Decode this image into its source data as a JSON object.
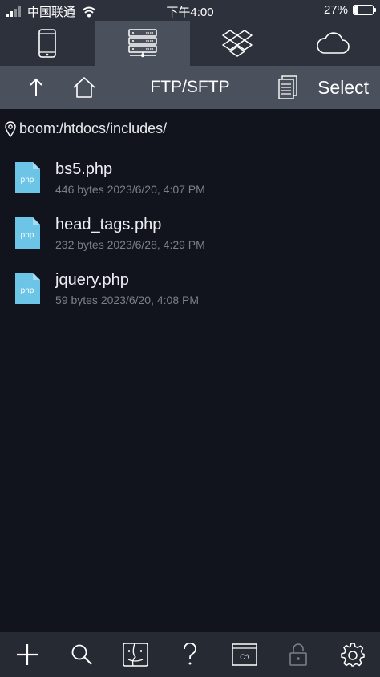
{
  "status": {
    "carrier": "中国联通",
    "time": "下午4:00",
    "battery": "27%",
    "battery_level": 0.27
  },
  "tabs": [
    {
      "name": "device",
      "icon": "phone-icon",
      "active": false
    },
    {
      "name": "server",
      "icon": "server-icon",
      "active": true
    },
    {
      "name": "dropbox",
      "icon": "dropbox-icon",
      "active": false
    },
    {
      "name": "cloud",
      "icon": "cloud-icon",
      "active": false
    }
  ],
  "toolbar": {
    "title": "FTP/SFTP",
    "select_label": "Select"
  },
  "path": "boom:/htdocs/includes/",
  "files": [
    {
      "name": "bs5.php",
      "meta": "446 bytes 2023/6/20, 4:07 PM",
      "ext": "php"
    },
    {
      "name": "head_tags.php",
      "meta": "232 bytes 2023/6/28, 4:29 PM",
      "ext": "php"
    },
    {
      "name": "jquery.php",
      "meta": "59 bytes 2023/6/20, 4:08 PM",
      "ext": "php"
    }
  ],
  "bottom": {
    "terminal_label": "C:\\"
  },
  "colors": {
    "background": "#11141d",
    "bar": "#2c313c",
    "toolbar": "#4a505c",
    "file_icon": "#6cc4e6"
  }
}
